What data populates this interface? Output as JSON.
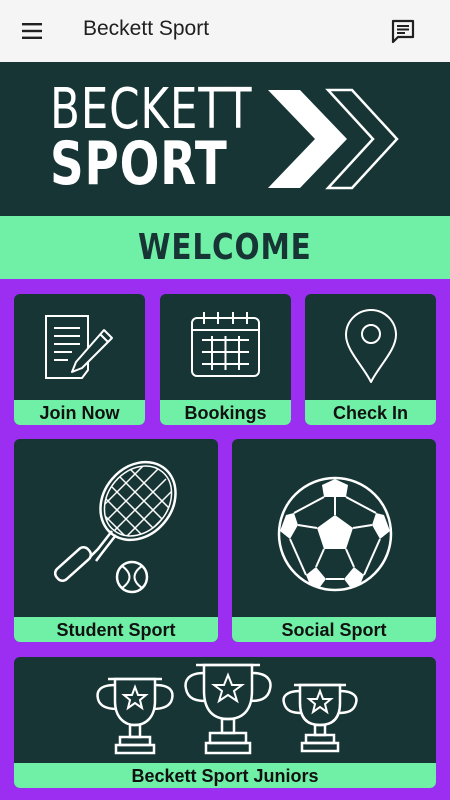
{
  "appbar": {
    "title": "Beckett Sport"
  },
  "banner": {
    "line1": "BECKETT",
    "line2": "SPORT"
  },
  "welcome": "WELCOME",
  "tiles": {
    "join": "Join Now",
    "bookings": "Bookings",
    "checkin": "Check In",
    "student": "Student Sport",
    "social": "Social Sport",
    "juniors": "Beckett Sport Juniors"
  },
  "colors": {
    "dark": "#173535",
    "mint": "#6ff0a6",
    "purple": "#9b2ef0",
    "appbar": "#f5f5f5"
  },
  "icons": [
    "menu-icon",
    "chat-icon",
    "document-pen-icon",
    "calendar-icon",
    "location-pin-icon",
    "tennis-racket-icon",
    "football-icon",
    "trophy-icon"
  ]
}
